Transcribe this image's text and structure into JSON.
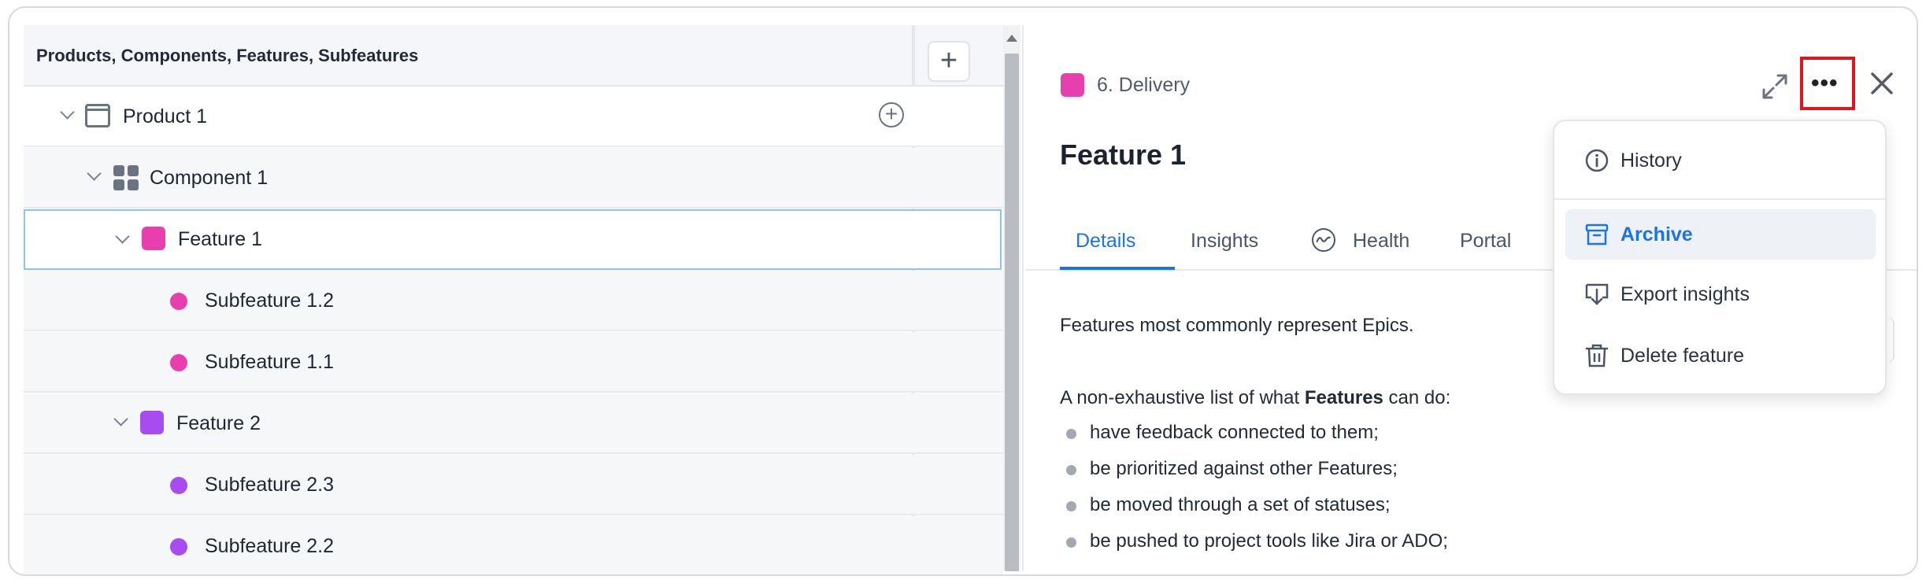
{
  "tree": {
    "header_title": "Products, Components, Features, Subfeatures",
    "add_column_label": "+",
    "rows": [
      {
        "label": "Product 1",
        "type": "product"
      },
      {
        "label": "Component 1",
        "type": "component"
      },
      {
        "label": "Feature 1",
        "type": "feature",
        "color": "#e83fae"
      },
      {
        "label": "Subfeature 1.2",
        "type": "subfeature",
        "color": "#e83fae"
      },
      {
        "label": "Subfeature 1.1",
        "type": "subfeature",
        "color": "#e83fae"
      },
      {
        "label": "Feature 2",
        "type": "feature",
        "color": "#a64cf0"
      },
      {
        "label": "Subfeature 2.3",
        "type": "subfeature",
        "color": "#a64cf0"
      },
      {
        "label": "Subfeature 2.2",
        "type": "subfeature",
        "color": "#a64cf0"
      }
    ]
  },
  "detail": {
    "status_label": "6. Delivery",
    "status_color": "#e83fae",
    "title": "Feature 1",
    "tabs": [
      {
        "label": "Details"
      },
      {
        "label": "Insights"
      },
      {
        "label": "Health"
      },
      {
        "label": "Portal"
      }
    ],
    "intro": "Features most commonly represent Epics.",
    "list_intro_pre": "A non-exhaustive list of what ",
    "list_intro_bold": "Features",
    "list_intro_post": " can do:",
    "bullets": [
      "have feedback connected to them;",
      "be prioritized against other Features;",
      "be moved through a set of statuses;",
      "be pushed to project tools like Jira or ADO;"
    ]
  },
  "menu": {
    "items": [
      {
        "label": "History",
        "icon": "info-icon"
      },
      {
        "label": "Archive",
        "icon": "archive-icon"
      },
      {
        "label": "Export insights",
        "icon": "export-icon"
      },
      {
        "label": "Delete feature",
        "icon": "trash-icon"
      }
    ]
  },
  "colors": {
    "accent": "#1a73e8",
    "highlight_box": "#e0161d",
    "selected_row_border": "#8fc2f4"
  }
}
